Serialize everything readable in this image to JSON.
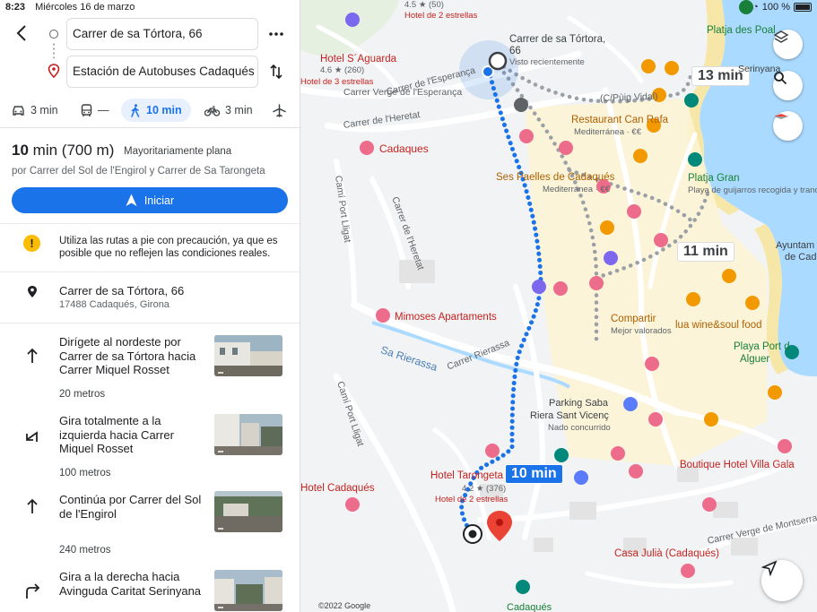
{
  "status_bar": {
    "time": "8:23",
    "date": "Miércoles 16 de marzo",
    "battery": "100 %"
  },
  "route_inputs": {
    "origin": "Carrer de sa Tórtora, 66",
    "destination": "Estación de Autobuses Cadaqués"
  },
  "modes": [
    {
      "name": "car",
      "label": "3 min"
    },
    {
      "name": "transit",
      "label": "—"
    },
    {
      "name": "walk",
      "label": "10 min",
      "active": true
    },
    {
      "name": "bike",
      "label": "3 min"
    },
    {
      "name": "flight",
      "label": ""
    }
  ],
  "summary": {
    "time": "10",
    "time_unit": "min",
    "distance": "(700 m)",
    "terrain": "Mayoritariamente plana",
    "via": "por Carrer del Sol de l'Engirol y Carrer de Sa Tarongeta",
    "start_label": "Iniciar"
  },
  "warning": "Utiliza las rutas a pie con precaución, ya que es posible que no reflejen las condiciones reales.",
  "origin": {
    "address": "Carrer de sa Tórtora, 66",
    "locality": "17488 Cadaqués, Girona"
  },
  "steps": [
    {
      "text": "Dirígete al nordeste por Carrer de sa Tórtora hacia Carrer Miquel Rosset",
      "distance": "20 metros",
      "icon": "arrow-up-icon"
    },
    {
      "text": "Gira totalmente a la izquierda hacia Carrer Miquel Rosset",
      "distance": "100 metros",
      "icon": "sharp-left-icon"
    },
    {
      "text": "Continúa por Carrer del Sol de l'Engirol",
      "distance": "240 metros",
      "icon": "arrow-up-icon"
    },
    {
      "text": "Gira a la derecha hacia Avinguda Caritat Serinyana",
      "distance": "",
      "icon": "turn-right-icon"
    }
  ],
  "map": {
    "copyright": "©2022 Google",
    "time_labels": {
      "main": "10 min",
      "alt1": "13 min",
      "alt2": "11 min"
    },
    "places": {
      "origin_name": "Carrer de sa Tórtora,",
      "origin_num": "66",
      "origin_sub": "Visto recientemente",
      "saguarda": "Hotel S´Aguarda",
      "saguarda_rating": "4.6 ★ (260)",
      "saguarda_type": "Hotel de 3 estrellas",
      "top_rating": "4.5 ★ (50)",
      "top_type": "Hotel de 2 estrellas",
      "cadaques": "Cadaques",
      "can_rafa": "Restaurant Can Rafa",
      "can_rafa_type": "Mediterránea · €€",
      "paelles": "Ses Paelles de Cadaqués",
      "paelles_type": "Mediterránea · €€",
      "platja_pol": "Platja des Poal",
      "platja_gran": "Platja Gran",
      "platja_gran_desc": "Playa de guijarros recogida y tranquila",
      "ayuntamiento": "Ayuntam",
      "ayunt2": "de Cadac",
      "mimoses": "Mimoses Apartaments",
      "compartir": "Compartir",
      "compartir_type": "Mejor valorados",
      "lua": "lua wine&soul food",
      "port_alguer1": "Playa Port d",
      "port_alguer2": "Alguer",
      "parking": "Parking Saba",
      "riera": "Riera Sant Vicenç",
      "riera_type": "Nado concurrido",
      "tarongeta": "Hotel Tarongeta",
      "tarongeta_rating": "4.2 ★ (376)",
      "tarongeta_type": "Hotel de 2 estrellas",
      "hotel_cadaques": "Hotel Cadaqués",
      "villa_gala": "Boutique Hotel Villa Gala",
      "casa_julia": "Casa Julià (Cadaqués)",
      "cadaques_bottom": "Cadaqués",
      "serinyana": "Serinyana"
    },
    "roads": {
      "pug_vidal": "(C/Pùig Vidal)",
      "esperanca": "Carrer de l'Esperança",
      "verge1": "Carrer Verge de l'Esperança",
      "heretat1": "Carrer de l'Heretat",
      "heretat2": "Carrer de l'Heretat",
      "port_ligat1": "Camí Port Lligat",
      "port_ligat2": "Camí Port Lligat",
      "rierassa": "Sa Rierassa",
      "carrer_rierassa": "Carrer Rierassa",
      "montserrat": "Carrer Verge de Montserrat"
    }
  }
}
